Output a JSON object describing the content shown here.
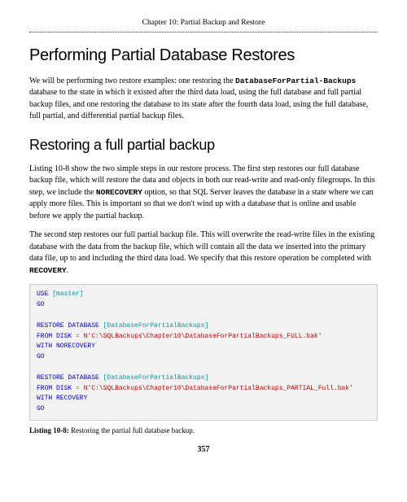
{
  "chapter_header": "Chapter 10: Partial Backup and Restore",
  "h1": "Performing Partial Database Restores",
  "p1_a": "We will be performing two restore examples: one restoring the ",
  "p1_mono": "DatabaseForPartial-Backups",
  "p1_b": " database to the state in which it existed after the third data load, using the full database and full partial backup files, and one restoring the database to its state after the fourth data load, using the full database, full partial, and differential partial backup files.",
  "h2": "Restoring a full partial backup",
  "p2_a": "Listing 10-8 show the two simple steps in our restore process. The first step restores our full database backup file, which will restore the data and objects in both our read-write and read-only filegroups. In this step, we include the ",
  "p2_mono": "NORECOVERY",
  "p2_b": " option, so that SQL Server leaves the database in a state where we can apply more files. This is important so that we don't wind up with a database that is online and usable before we apply the partial backup.",
  "p3_a": "The second step restores our full partial backup file. This will overwrite the read-write files in the existing database with the data from the backup file, which will contain all the data we inserted into the primary data file, up to and including the third data load. We specify that this restore operation be completed with ",
  "p3_mono": "RECOVERY",
  "p3_b": ".",
  "code": {
    "l1_kw": "USE",
    "l1_obj": "[master]",
    "l2_kw": "GO",
    "l3_kw": "RESTORE DATABASE",
    "l3_obj": "[DatabaseForPartialBackups]",
    "l4_kw1": "FROM DISK",
    "l4_op": "=",
    "l4_str": "N'C:\\SQLBackups\\Chapter10\\DatabaseForPartialBackups_FULL.bak'",
    "l5_kw": "WITH NORECOVERY",
    "l6_kw": "GO",
    "l7_kw": "RESTORE DATABASE",
    "l7_obj": "[DatabaseForPartialBackups]",
    "l8_kw1": "FROM DISK",
    "l8_op": "=",
    "l8_str": "N'C:\\SQLBackups\\Chapter10\\DatabaseForPartialBackups_PARTIAL_Full.bak'",
    "l9_kw": "WITH RECOVERY",
    "l10_kw": "GO"
  },
  "listing_label": "Listing 10-8:",
  "listing_text": " Restoring the partial full database backup.",
  "page_number": "357"
}
